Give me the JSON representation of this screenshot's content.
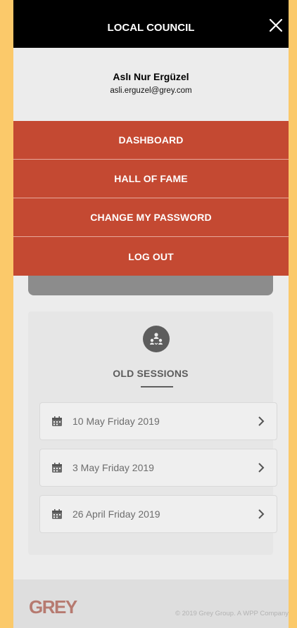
{
  "header": {
    "title": "LOCAL COUNCIL"
  },
  "profile": {
    "name": "Aslı Nur Ergüzel",
    "email": "asli.erguzel@grey.com"
  },
  "menu": {
    "items": [
      {
        "label": "DASHBOARD"
      },
      {
        "label": "HALL OF FAME"
      },
      {
        "label": "CHANGE MY PASSWORD"
      },
      {
        "label": "LOG OUT"
      }
    ]
  },
  "sessions": {
    "title": "OLD SESSIONS",
    "items": [
      {
        "label": "10 May Friday 2019"
      },
      {
        "label": "3 May Friday 2019"
      },
      {
        "label": "26 April Friday 2019"
      }
    ]
  },
  "footer": {
    "logo": "GREY",
    "copyright": "© 2019 Grey Group. A WPP Company"
  },
  "colors": {
    "accent": "#c44932",
    "topbar": "#000000",
    "background": "#fbc96a"
  },
  "icons": {
    "close": "close-icon",
    "people": "people-icon",
    "calendar": "calendar-icon",
    "chevron": "chevron-right-icon"
  }
}
